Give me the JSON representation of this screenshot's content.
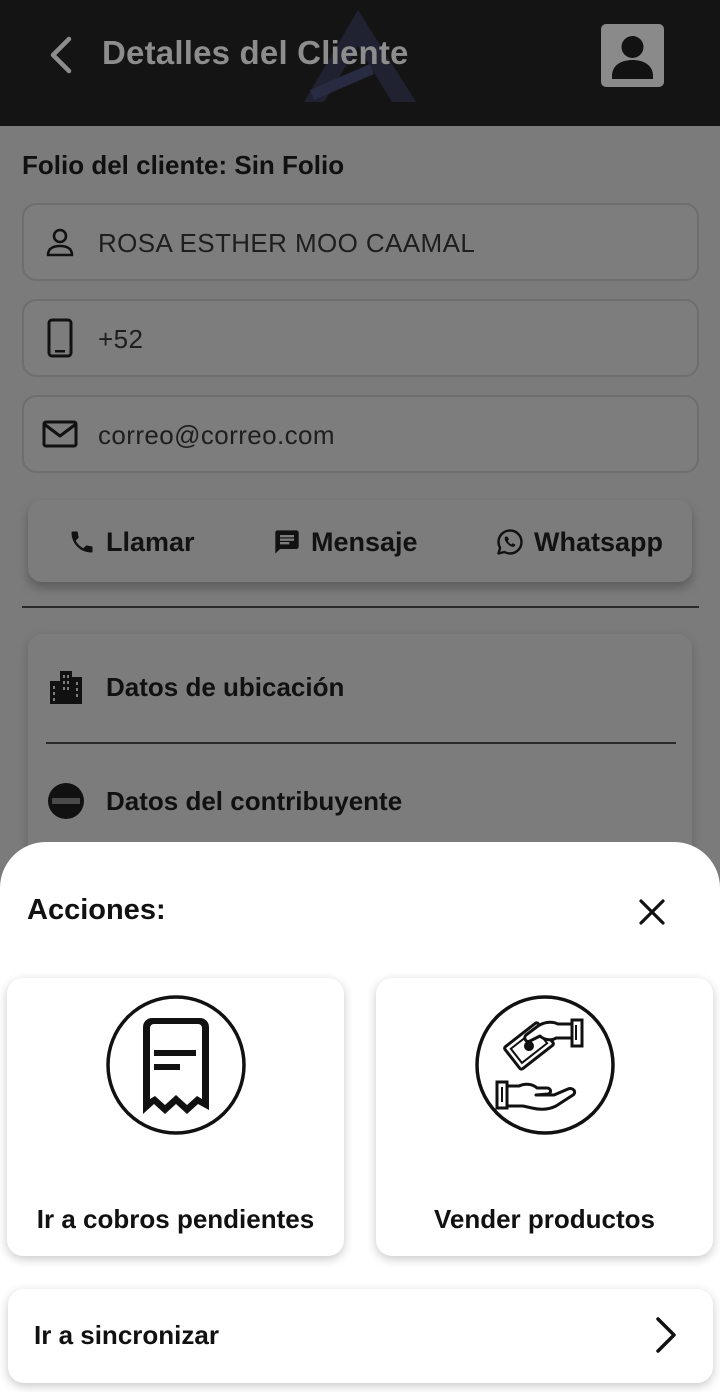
{
  "header": {
    "title": "Detalles del Cliente"
  },
  "client": {
    "folio_label": "Folio del cliente: Sin Folio",
    "name": "ROSA ESTHER MOO CAAMAL",
    "phone": "+52",
    "email": "correo@correo.com"
  },
  "contact_actions": {
    "call_label": "Llamar",
    "message_label": "Mensaje",
    "whatsapp_label": "Whatsapp"
  },
  "info_sections": [
    {
      "label": "Datos de ubicación",
      "icon": "buildings-icon"
    },
    {
      "label": "Datos del contribuyente",
      "icon": "contributor-icon"
    }
  ],
  "sheet": {
    "title": "Acciones:",
    "actions": [
      {
        "label": "Ir a cobros pendientes",
        "icon": "receipt-icon"
      },
      {
        "label": "Vender productos",
        "icon": "money-exchange-icon"
      }
    ],
    "sync_label": "Ir a sincronizar"
  },
  "colors": {
    "appbar": "#141414",
    "overlay_background": "#7b7b7b",
    "sheet_background": "#ffffff"
  }
}
